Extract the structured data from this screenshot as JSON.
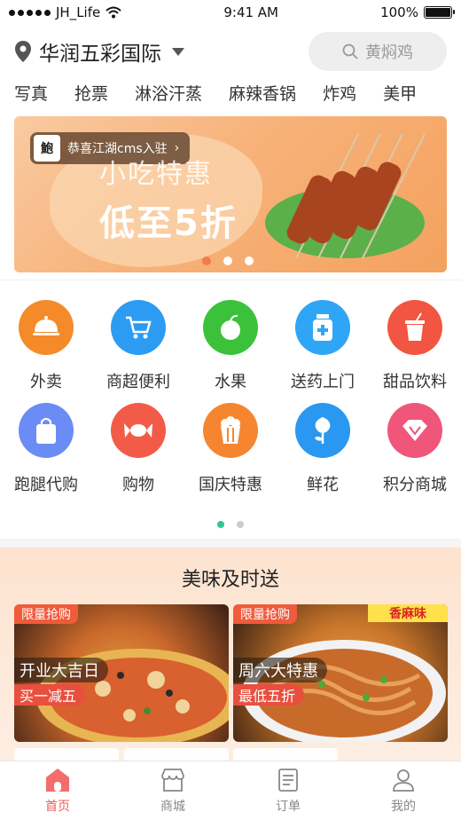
{
  "status_bar": {
    "carrier": "JH_Life",
    "time": "9:41 AM",
    "battery": "100%"
  },
  "header": {
    "location": "华润五彩国际",
    "search_placeholder": "黄焖鸡"
  },
  "nav_tabs": [
    "写真",
    "抢票",
    "淋浴汗蒸",
    "麻辣香锅",
    "炸鸡",
    "美甲"
  ],
  "banner": {
    "shop_notice": "恭喜江湖cms入驻",
    "subtitle": "小吃特惠",
    "headline": "低至5折",
    "slides": 3,
    "active_slide": 1
  },
  "categories": [
    {
      "label": "外卖",
      "icon": "cloche-icon",
      "color": "#f58a2b"
    },
    {
      "label": "商超便利",
      "icon": "cart-icon",
      "color": "#2b9cf2"
    },
    {
      "label": "水果",
      "icon": "apple-icon",
      "color": "#3cc23a"
    },
    {
      "label": "送药上门",
      "icon": "medicine-icon",
      "color": "#2fa6f5"
    },
    {
      "label": "甜品饮料",
      "icon": "drink-icon",
      "color": "#f25541"
    },
    {
      "label": "跑腿代购",
      "icon": "bag-icon",
      "color": "#6b8cf5"
    },
    {
      "label": "购物",
      "icon": "candy-icon",
      "color": "#f35b49"
    },
    {
      "label": "国庆特惠",
      "icon": "popcorn-icon",
      "color": "#f5862f"
    },
    {
      "label": "鲜花",
      "icon": "flower-icon",
      "color": "#2a98f0"
    },
    {
      "label": "积分商城",
      "icon": "diamond-icon",
      "color": "#f0557a"
    }
  ],
  "pagination": {
    "pages": 2,
    "active": 0
  },
  "promo": {
    "title": "美味及时送",
    "cards": [
      {
        "badge": "限量抢购",
        "title": "开业大吉日",
        "subtitle": "买一减五",
        "corner": ""
      },
      {
        "badge": "限量抢购",
        "title": "周六大特惠",
        "subtitle": "最低五折",
        "corner": "香麻味"
      }
    ]
  },
  "tabbar": [
    {
      "label": "首页",
      "icon": "home-icon",
      "active": true
    },
    {
      "label": "商城",
      "icon": "store-icon",
      "active": false
    },
    {
      "label": "订单",
      "icon": "order-icon",
      "active": false
    },
    {
      "label": "我的",
      "icon": "profile-icon",
      "active": false
    }
  ],
  "colors": {
    "accent": "#ef5b5b",
    "pager_active": "#35c58b",
    "promo_bg": "#fde3cf"
  }
}
